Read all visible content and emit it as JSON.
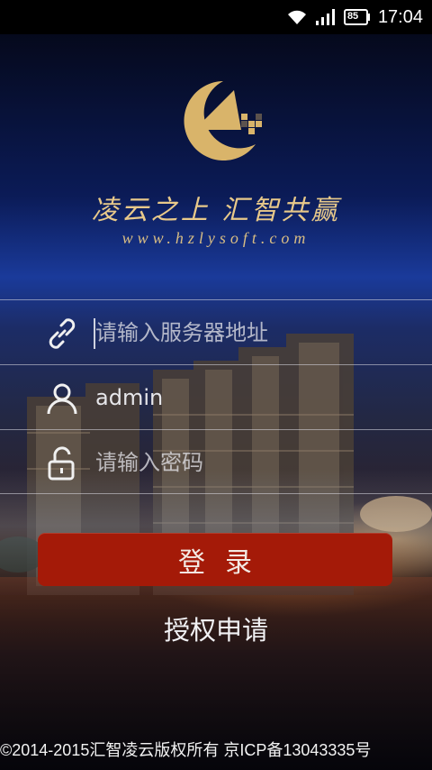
{
  "status_bar": {
    "time": "17:04",
    "battery": "85",
    "icons": [
      "wifi-icon",
      "signal-icon",
      "battery-icon"
    ]
  },
  "header": {
    "logo_icon": "company-logo",
    "slogan": "凌云之上 汇智共赢",
    "website": "www.hzlysoft.com"
  },
  "form": {
    "server": {
      "icon": "link-icon",
      "value": "",
      "placeholder": "请输入服务器地址"
    },
    "username": {
      "icon": "user-icon",
      "value": "admin",
      "placeholder": ""
    },
    "password": {
      "icon": "unlock-icon",
      "value": "",
      "placeholder": "请输入密码"
    }
  },
  "actions": {
    "login_label": "登录",
    "apply_label": "授权申请"
  },
  "footer": {
    "text": "©2014-2015汇智凌云版权所有 京ICP备13043335号"
  },
  "colors": {
    "brand_gold": "#e8c98a",
    "login_button": "#a41a08"
  }
}
